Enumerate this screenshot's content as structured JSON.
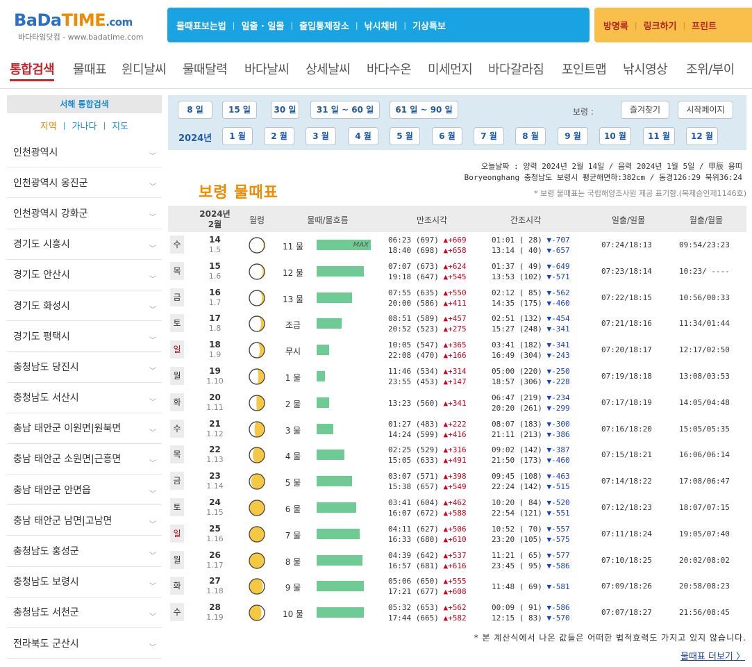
{
  "logo": {
    "brand_bada": "BaDa",
    "brand_time": "TIME",
    "brand_com": ".com",
    "subtitle": "바다타임닷컴 - www.badatime.com"
  },
  "top_nav": [
    "물때표보는법",
    "일출 · 일몰",
    "출입통제장소",
    "낚시채비",
    "기상특보"
  ],
  "side_nav": [
    "방명록",
    "링크하기",
    "프린트"
  ],
  "main_tabs": [
    "통합검색",
    "물때표",
    "윈디날씨",
    "물때달력",
    "바다날씨",
    "상세날씨",
    "바다수온",
    "미세먼지",
    "바다갈라짐",
    "포인트맵",
    "낚시영상",
    "조위/부이"
  ],
  "sidebar": {
    "title": "서해 통합검색",
    "filters": [
      "지역",
      "가나다",
      "지도"
    ],
    "regions": [
      "인천광역시",
      "인천광역시 옹진군",
      "인천광역시 강화군",
      "경기도 시흥시",
      "경기도 안산시",
      "경기도 화성시",
      "경기도 평택시",
      "충청남도 당진시",
      "충청남도 서산시",
      "충남 태안군 이원면|원북면",
      "충남 태안군 소원면|근흥면",
      "충남 태안군 안면읍",
      "충남 태안군 남면|고남면",
      "충청남도 홍성군",
      "충청남도 보령시",
      "충청남도 서천군",
      "전라북도 군산시"
    ]
  },
  "periods": [
    "8 일",
    "15 일",
    "30 일",
    "31 일 ~ 60 일",
    "61 일 ~ 90 일"
  ],
  "location_label": "보령 :",
  "buttons": {
    "favorite": "즐겨찾기",
    "start_page": "시작페이지"
  },
  "year_label": "2024년",
  "months": [
    "1 월",
    "2 월",
    "3 월",
    "4 월",
    "5 월",
    "6 월",
    "7 월",
    "8 월",
    "9 월",
    "10 월",
    "11 월",
    "12 월"
  ],
  "info": {
    "line1": "오늘날짜 : 양력 2024년 2월 14일 / 음력 2024년 1월 5일 / 甲辰 용띠",
    "line2": "Boryeonghang 충청남도 보령시 평균해면하:382cm / 동경126:29 북위36:24",
    "line3": "* 보령 물때표는 국립해양조사원 제공 표기함.(복제승인제1146호)"
  },
  "page_title": "보령 물때표",
  "table": {
    "headers": {
      "date": "2024년\n2월",
      "moon": "월령",
      "tide": "물때/물흐름",
      "high": "만조시각",
      "low": "간조시각",
      "sun": "일출/일몰",
      "moonrise": "월출/월몰"
    },
    "max_label": "MAX",
    "rows": [
      {
        "dow": "수",
        "red": false,
        "day": "14",
        "lunar": "1.5",
        "phase": 0.17,
        "mul": "11 물",
        "flow": 1.0,
        "high": [
          "06:23 (697) ",
          "▲+669",
          "18:40 (698) ",
          "▲+658"
        ],
        "low": [
          "01:01 ( 28) ",
          "▼-707",
          "13:14 ( 40) ",
          "▼-657"
        ],
        "sun": "07:24/18:13",
        "moon": "09:54/23:23"
      },
      {
        "dow": "목",
        "red": false,
        "day": "15",
        "lunar": "1.6",
        "phase": 0.22,
        "mul": "12 물",
        "flow": 0.87,
        "high": [
          "07:07 (673) ",
          "▲+624",
          "19:18 (647) ",
          "▲+545"
        ],
        "low": [
          "01:37 ( 49) ",
          "▼-649",
          "13:53 (102) ",
          "▼-571"
        ],
        "sun": "07:23/18:14",
        "moon": "10:23/ ----"
      },
      {
        "dow": "금",
        "red": false,
        "day": "16",
        "lunar": "1.7",
        "phase": 0.27,
        "mul": "13 물",
        "flow": 0.66,
        "high": [
          "07:55 (635) ",
          "▲+550",
          "20:00 (586) ",
          "▲+411"
        ],
        "low": [
          "02:12 ( 85) ",
          "▼-562",
          "14:35 (175) ",
          "▼-460"
        ],
        "sun": "07:22/18:15",
        "moon": "10:56/00:33"
      },
      {
        "dow": "토",
        "red": false,
        "day": "17",
        "lunar": "1.8",
        "phase": 0.32,
        "mul": "조금",
        "flow": 0.46,
        "high": [
          "08:51 (589) ",
          "▲+457",
          "20:52 (523) ",
          "▲+275"
        ],
        "low": [
          "02:51 (132) ",
          "▼-454",
          "15:27 (248) ",
          "▼-341"
        ],
        "sun": "07:21/18:16",
        "moon": "11:34/01:44"
      },
      {
        "dow": "일",
        "red": true,
        "day": "18",
        "lunar": "1.9",
        "phase": 0.38,
        "mul": "무시",
        "flow": 0.23,
        "high": [
          "10:05 (547) ",
          "▲+365",
          "22:08 (470) ",
          "▲+166"
        ],
        "low": [
          "03:41 (182) ",
          "▼-341",
          "16:49 (304) ",
          "▼-243"
        ],
        "sun": "07:20/18:17",
        "moon": "12:17/02:50"
      },
      {
        "dow": "월",
        "red": false,
        "day": "19",
        "lunar": "1.10",
        "phase": 0.44,
        "mul": "1 물",
        "flow": 0.15,
        "high": [
          "11:46 (534) ",
          "▲+314",
          "23:55 (453) ",
          "▲+147"
        ],
        "low": [
          "05:00 (220) ",
          "▼-250",
          "18:57 (306) ",
          "▼-228"
        ],
        "sun": "07:19/18:18",
        "moon": "13:08/03:53"
      },
      {
        "dow": "화",
        "red": false,
        "day": "20",
        "lunar": "1.11",
        "phase": 0.52,
        "mul": "2 물",
        "flow": 0.23,
        "high": [
          "13:23 (560) ",
          "▲+341",
          "",
          ""
        ],
        "low": [
          "06:47 (219) ",
          "▼-234",
          "20:20 (261) ",
          "▼-299"
        ],
        "sun": "07:17/18:19",
        "moon": "14:05/04:48"
      },
      {
        "dow": "수",
        "red": false,
        "day": "21",
        "lunar": "1.12",
        "phase": 0.6,
        "mul": "3 물",
        "flow": 0.31,
        "high": [
          "01:27 (483) ",
          "▲+222",
          "14:24 (599) ",
          "▲+416"
        ],
        "low": [
          "08:07 (183) ",
          "▼-300",
          "21:11 (213) ",
          "▼-386"
        ],
        "sun": "07:16/18:20",
        "moon": "15:05/05:35"
      },
      {
        "dow": "목",
        "red": false,
        "day": "22",
        "lunar": "1.13",
        "phase": 0.68,
        "mul": "4 물",
        "flow": 0.51,
        "high": [
          "02:25 (529) ",
          "▲+316",
          "15:05 (633) ",
          "▲+491"
        ],
        "low": [
          "09:02 (142) ",
          "▼-387",
          "21:50 (173) ",
          "▼-460"
        ],
        "sun": "07:15/18:21",
        "moon": "16:06/06:14"
      },
      {
        "dow": "금",
        "red": false,
        "day": "23",
        "lunar": "1.14",
        "phase": 0.77,
        "mul": "5 물",
        "flow": 0.65,
        "high": [
          "03:07 (571) ",
          "▲+398",
          "15:38 (657) ",
          "▲+549"
        ],
        "low": [
          "09:45 (108) ",
          "▼-463",
          "22:24 (142) ",
          "▼-515"
        ],
        "sun": "07:14/18:22",
        "moon": "17:08/06:47"
      },
      {
        "dow": "토",
        "red": false,
        "day": "24",
        "lunar": "1.15",
        "phase": 0.88,
        "mul": "6 물",
        "flow": 0.73,
        "high": [
          "03:41 (604) ",
          "▲+462",
          "16:07 (672) ",
          "▲+588"
        ],
        "low": [
          "10:20 ( 84) ",
          "▼-520",
          "22:54 (121) ",
          "▼-551"
        ],
        "sun": "07:12/18:23",
        "moon": "18:07/07:15"
      },
      {
        "dow": "일",
        "red": true,
        "day": "25",
        "lunar": "1.16",
        "phase": 1.0,
        "mul": "7 물",
        "flow": 0.79,
        "high": [
          "04:11 (627) ",
          "▲+506",
          "16:33 (680) ",
          "▲+610"
        ],
        "low": [
          "10:52 ( 70) ",
          "▼-557",
          "23:20 (105) ",
          "▼-575"
        ],
        "sun": "07:11/18:24",
        "moon": "19:05/07:40"
      },
      {
        "dow": "월",
        "red": false,
        "day": "26",
        "lunar": "1.17",
        "phase": 1.12,
        "mul": "8 물",
        "flow": 0.85,
        "high": [
          "04:39 (642) ",
          "▲+537",
          "16:57 (681) ",
          "▲+616"
        ],
        "low": [
          "11:21 ( 65) ",
          "▼-577",
          "23:45 ( 95) ",
          "▼-586"
        ],
        "sun": "07:10/18:25",
        "moon": "20:02/08:02"
      },
      {
        "dow": "화",
        "red": false,
        "day": "27",
        "lunar": "1.18",
        "phase": 1.22,
        "mul": "9 물",
        "flow": 0.87,
        "high": [
          "05:06 (650) ",
          "▲+555",
          "17:21 (677) ",
          "▲+608"
        ],
        "low": [
          "11:48 ( 69) ",
          "▼-581",
          "",
          ""
        ],
        "sun": "07:09/18:26",
        "moon": "20:58/08:23"
      },
      {
        "dow": "수",
        "red": false,
        "day": "28",
        "lunar": "1.19",
        "phase": 1.3,
        "mul": "10 물",
        "flow": 0.87,
        "high": [
          "05:32 (653) ",
          "▲+562",
          "17:44 (665) ",
          "▲+582"
        ],
        "low": [
          "00:09 ( 91) ",
          "▼-586",
          "12:15 ( 83) ",
          "▼-570"
        ],
        "sun": "07:07/18:27",
        "moon": "21:56/08:45"
      }
    ]
  },
  "disclaimer": "* 본 계산식에서 나온 값들은 어떠한 법적효력도 가지고 있지 않습니다.",
  "more_link": "물때표 더보기 〉",
  "colors": {
    "accent_blue": "#1aa3e2",
    "accent_gold": "#f8c04b",
    "title_orange": "#f08a00",
    "active_red": "#c0282c",
    "flow_green": "#6ecb94",
    "moon_yellow": "#f5c842"
  }
}
